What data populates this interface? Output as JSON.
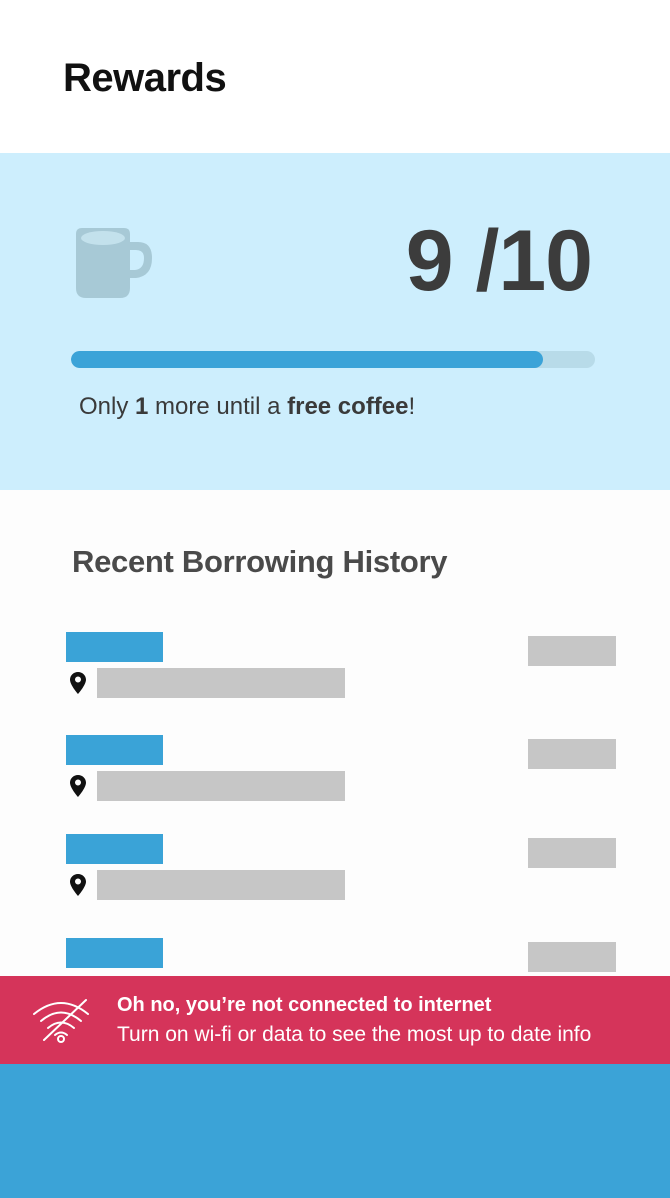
{
  "header": {
    "title": "Rewards"
  },
  "rewards": {
    "stamps_label": "9 /10",
    "progress_fraction": 0.9,
    "message": {
      "prefix": "Only ",
      "count": "1",
      "middle": " more until a ",
      "reward": "free coffee",
      "suffix": "!"
    },
    "icon": "coffee-mug-icon"
  },
  "history": {
    "title": "Recent Borrowing History",
    "items_visible": 4,
    "location_icon": "map-pin-icon"
  },
  "offline_banner": {
    "title": "Oh no, you’re not connected to internet",
    "message": "Turn on wi-fi or data to see the most up to date info",
    "icon": "wifi-off-icon"
  },
  "colors": {
    "accent_blue": "#3ba3d7",
    "card_background": "#cdeefd",
    "banner_red": "#d5345a",
    "placeholder_gray": "#c6c6c6"
  }
}
